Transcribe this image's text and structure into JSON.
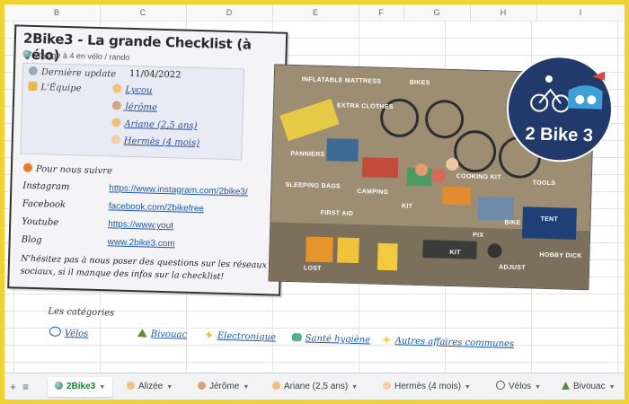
{
  "columns": [
    "B",
    "C",
    "D",
    "E",
    "F",
    "G",
    "H",
    "I"
  ],
  "card": {
    "title": "2Bike3 - La grande Checklist (à vélo)",
    "subtitle": "Voyage à 4 en vélo / rando",
    "update_label": "Dernière update",
    "update_value": "11/04/2022",
    "team_label": "L'Équipe",
    "team": [
      "Lycou",
      "Jérôme",
      "Ariane (2,5 ans)",
      "Hermès (4 mois)"
    ],
    "follow_title": "Pour nous suivre",
    "social": [
      {
        "name": "Instagram",
        "link": "https://www.instagram.com/2bike3/"
      },
      {
        "name": "Facebook",
        "link": "facebook.com/2bikefree"
      },
      {
        "name": "Youtube",
        "link": "https://www.yout"
      },
      {
        "name": "Blog",
        "link": "www.2bike3.com"
      }
    ],
    "note": "N'hésitez pas à nous poser des questions sur les réseaux sociaux, si il manque des infos sur la checklist!"
  },
  "photo_labels": [
    "INFLATABLE MATTRESS",
    "EXTRA CLOTHES",
    "PANNIERS",
    "BIKES",
    "SLEEPING BAGS",
    "KIT",
    "TOOLS",
    "COOKING KIT",
    "TENT",
    "PIX",
    "FIRST AID",
    "CAMPING",
    "LOST",
    "ADJUST",
    "KIT",
    "HOBBY DICK",
    "BIKE"
  ],
  "logo_text": "2 Bike 3",
  "categories_title": "Les catégories",
  "categories": [
    "Vélos",
    "Bivouac",
    "Electronique",
    "Santé hygiène",
    "Autres affaires communes"
  ],
  "tabs": [
    {
      "label": "2Bike3",
      "active": true
    },
    {
      "label": "Alizée"
    },
    {
      "label": "Jérôme"
    },
    {
      "label": "Ariane (2,5 ans)"
    },
    {
      "label": "Hermès (4 mois)"
    },
    {
      "label": "Vélos"
    },
    {
      "label": "Bivouac"
    }
  ],
  "colors": {
    "frame": "#f2d233",
    "active_tab": "#188038",
    "link": "#1a57b3"
  }
}
